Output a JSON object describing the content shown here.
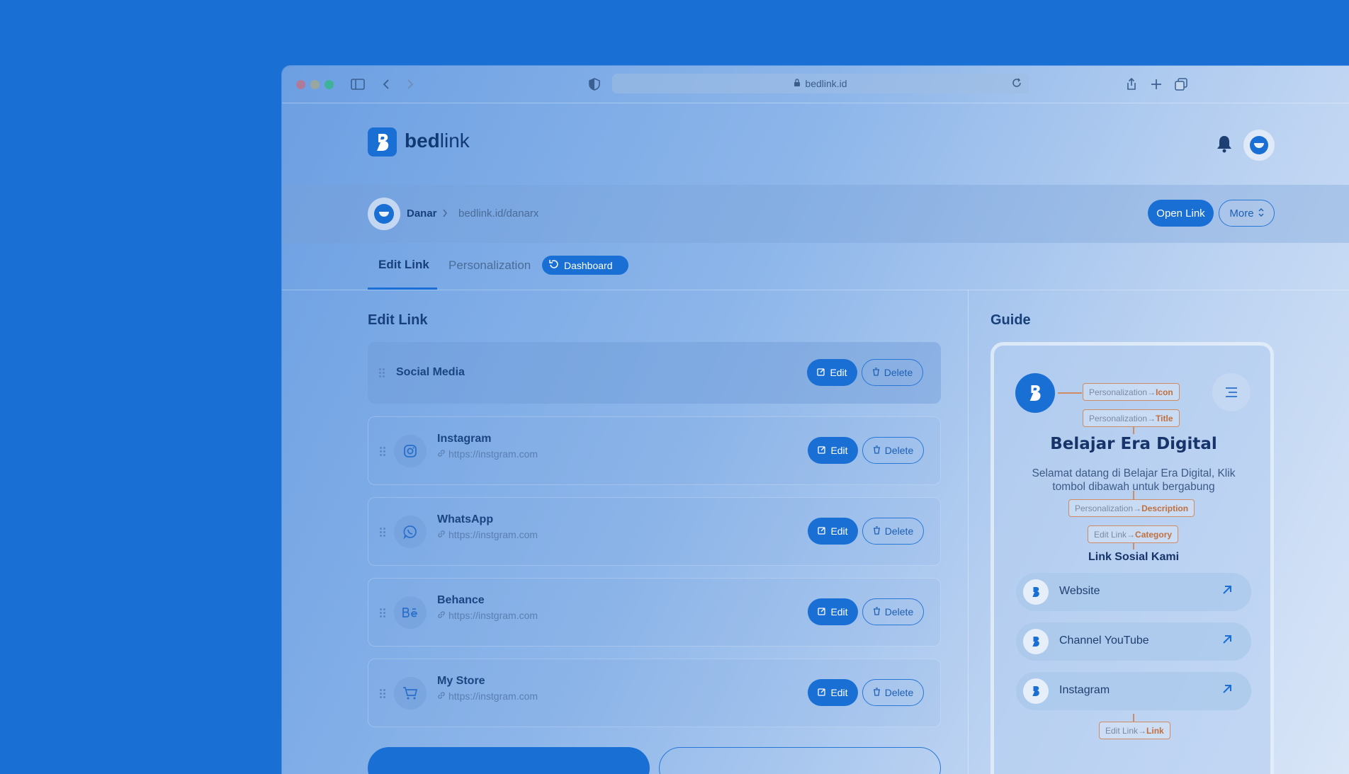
{
  "browser": {
    "url": "bedlink.id"
  },
  "app": {
    "brand_bold": "bed",
    "brand_light": "link"
  },
  "breadcrumb": {
    "name": "Danar",
    "link": "bedlink.id/danarx"
  },
  "actions": {
    "open_link": "Open Link",
    "more": "More"
  },
  "tabs": [
    {
      "label": "Edit Link",
      "active": true
    },
    {
      "label": "Personalization",
      "active": false
    },
    {
      "label": "Dashboard",
      "active": false
    }
  ],
  "edit_section": {
    "title": "Edit Link",
    "category": {
      "name": "Social Media"
    },
    "links": [
      {
        "name": "Instagram",
        "url": "https://instgram.com",
        "icon": "instagram-icon"
      },
      {
        "name": "WhatsApp",
        "url": "https://instgram.com",
        "icon": "whatsapp-icon"
      },
      {
        "name": "Behance",
        "url": "https://instgram.com",
        "icon": "behance-icon"
      },
      {
        "name": "My Store",
        "url": "https://instgram.com",
        "icon": "cart-icon"
      }
    ],
    "edit_label": "Edit",
    "delete_label": "Delete"
  },
  "guide": {
    "title": "Guide",
    "preview_title": "Belajar Era Digital",
    "preview_desc": "Selamat datang di Belajar Era Digital, Klik tombol dibawah untuk bergabung",
    "category": "Link Sosial Kami",
    "links": [
      "Website",
      "Channel YouTube",
      "Instagram"
    ],
    "tags": {
      "icon_prefix": "Personalization",
      "icon_key": "Icon",
      "title_prefix": "Personalization",
      "title_key": "Title",
      "desc_prefix": "Personalization",
      "desc_key": "Description",
      "cat_prefix": "Edit Link",
      "cat_key": "Category",
      "link_prefix": "Edit Link",
      "link_key": "Link"
    }
  },
  "colors": {
    "accent": "#1a6fd4",
    "background": "#1a6fd4",
    "tag_border": "#d18b62"
  }
}
